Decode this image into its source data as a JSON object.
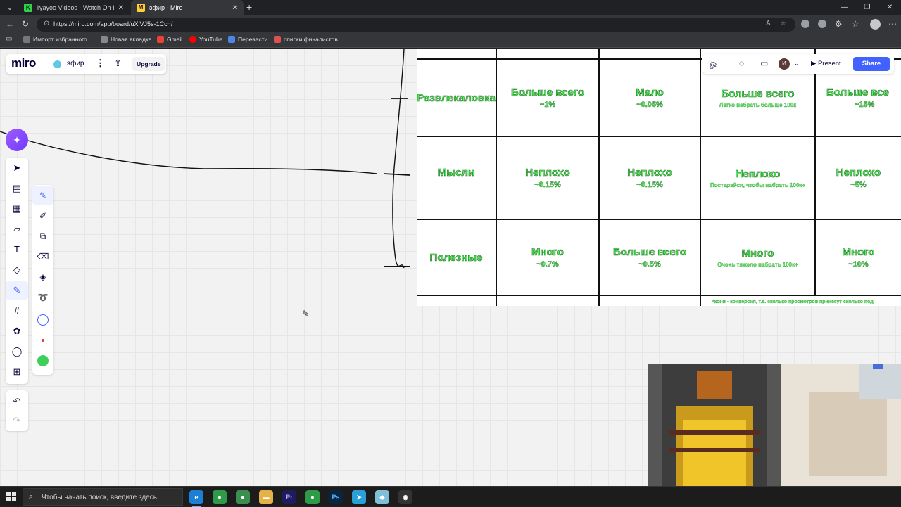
{
  "browser": {
    "tabs": [
      {
        "title": "ilyayoo Videos - Watch On-Dema",
        "favicon": "K"
      },
      {
        "title": "эфир - Miro",
        "favicon": "M"
      }
    ],
    "url": "https://miro.com/app/board/uXjVJ5s-1Cc=/",
    "bookmarks": [
      "Импорт избранного",
      "Новая вкладка",
      "Gmail",
      "YouTube",
      "Перевести",
      "списки финалистов..."
    ]
  },
  "miro": {
    "logo": "miro",
    "board_name": "эфир",
    "upgrade_label": "Upgrade",
    "avatar_initial": "И",
    "present_label": "Present",
    "share_label": "Share",
    "accent": "#4262ff"
  },
  "table": {
    "rows": [
      {
        "category": "Развлекаловка",
        "cells": [
          {
            "main": "Больше всего",
            "sub": "~1%"
          },
          {
            "main": "Мало",
            "sub": "~0.05%"
          },
          {
            "main": "Больше всего",
            "note": "Легко набрать больше 100к"
          },
          {
            "main": "Больше все",
            "sub": "~15%"
          }
        ]
      },
      {
        "category": "Мысли",
        "cells": [
          {
            "main": "Неплохо",
            "sub": "~0.15%"
          },
          {
            "main": "Неплохо",
            "sub": "~0.15%"
          },
          {
            "main": "Неплохо",
            "note": "Постарайся, чтобы набрать 100к+"
          },
          {
            "main": "Неплохо",
            "sub": "~5%"
          }
        ]
      },
      {
        "category": "Полезные",
        "cells": [
          {
            "main": "Много",
            "sub": "~0.7%"
          },
          {
            "main": "Больше всего",
            "sub": "~0.5%"
          },
          {
            "main": "Много",
            "note": "Очень тяжело набрать 100к+"
          },
          {
            "main": "Много",
            "sub": "~10%"
          }
        ]
      }
    ],
    "footnote": "*конв - конверсия, т.е. сколько просмотров принесут сколько под",
    "text_color": "#5bf061"
  },
  "taskbar": {
    "search_placeholder": "Чтобы начать поиск, введите здесь"
  }
}
